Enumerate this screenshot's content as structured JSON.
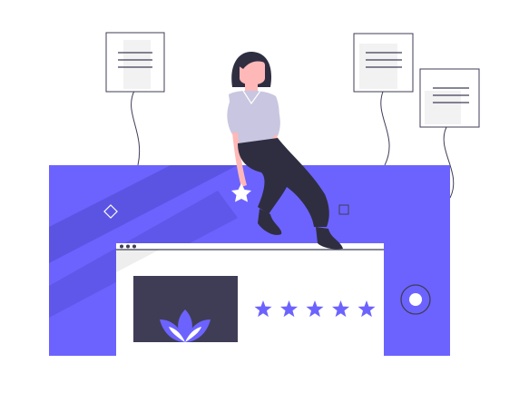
{
  "illustration": {
    "subject": "woman-sitting-on-review-panel",
    "rating": {
      "stars": 5,
      "max": 5
    },
    "icons": [
      "note-card-icon",
      "star-icon",
      "lotus-icon",
      "record-button-icon",
      "diamond-icon",
      "square-icon"
    ]
  },
  "colors": {
    "accent": "#6c63ff",
    "accent_dark": "#5a52e0",
    "ink": "#2f2e41",
    "image_tile": "#3f3d56",
    "shirt": "#c8c6e0",
    "skin": "#ffb8b8",
    "frame": "#e6e6e6",
    "white": "#ffffff"
  }
}
